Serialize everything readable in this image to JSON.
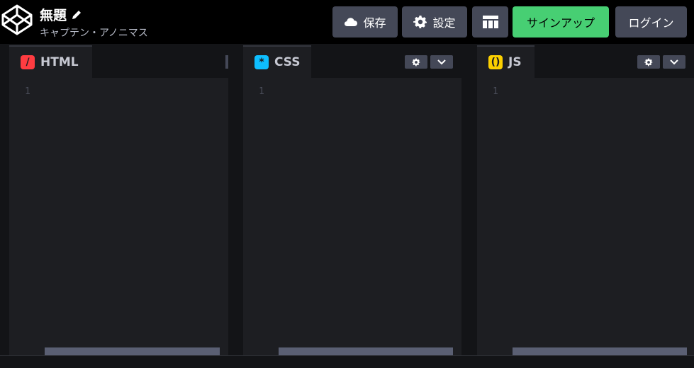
{
  "header": {
    "title": "無題",
    "subtitle": "キャプテン・アノニマス",
    "save_label": "保存",
    "settings_label": "設定",
    "signup_label": "サインアップ",
    "login_label": "ログイン"
  },
  "editors": [
    {
      "label": "HTML",
      "icon": "html-icon",
      "line_number": "1",
      "color": "#ff3c41"
    },
    {
      "label": "CSS",
      "icon": "css-icon",
      "line_number": "1",
      "color": "#0ebeff"
    },
    {
      "label": "JS",
      "icon": "js-icon",
      "line_number": "1",
      "color": "#fcd000"
    }
  ],
  "colors": {
    "signup_green": "#47cf73",
    "button_gray": "#444857",
    "header_bg": "#000000"
  }
}
